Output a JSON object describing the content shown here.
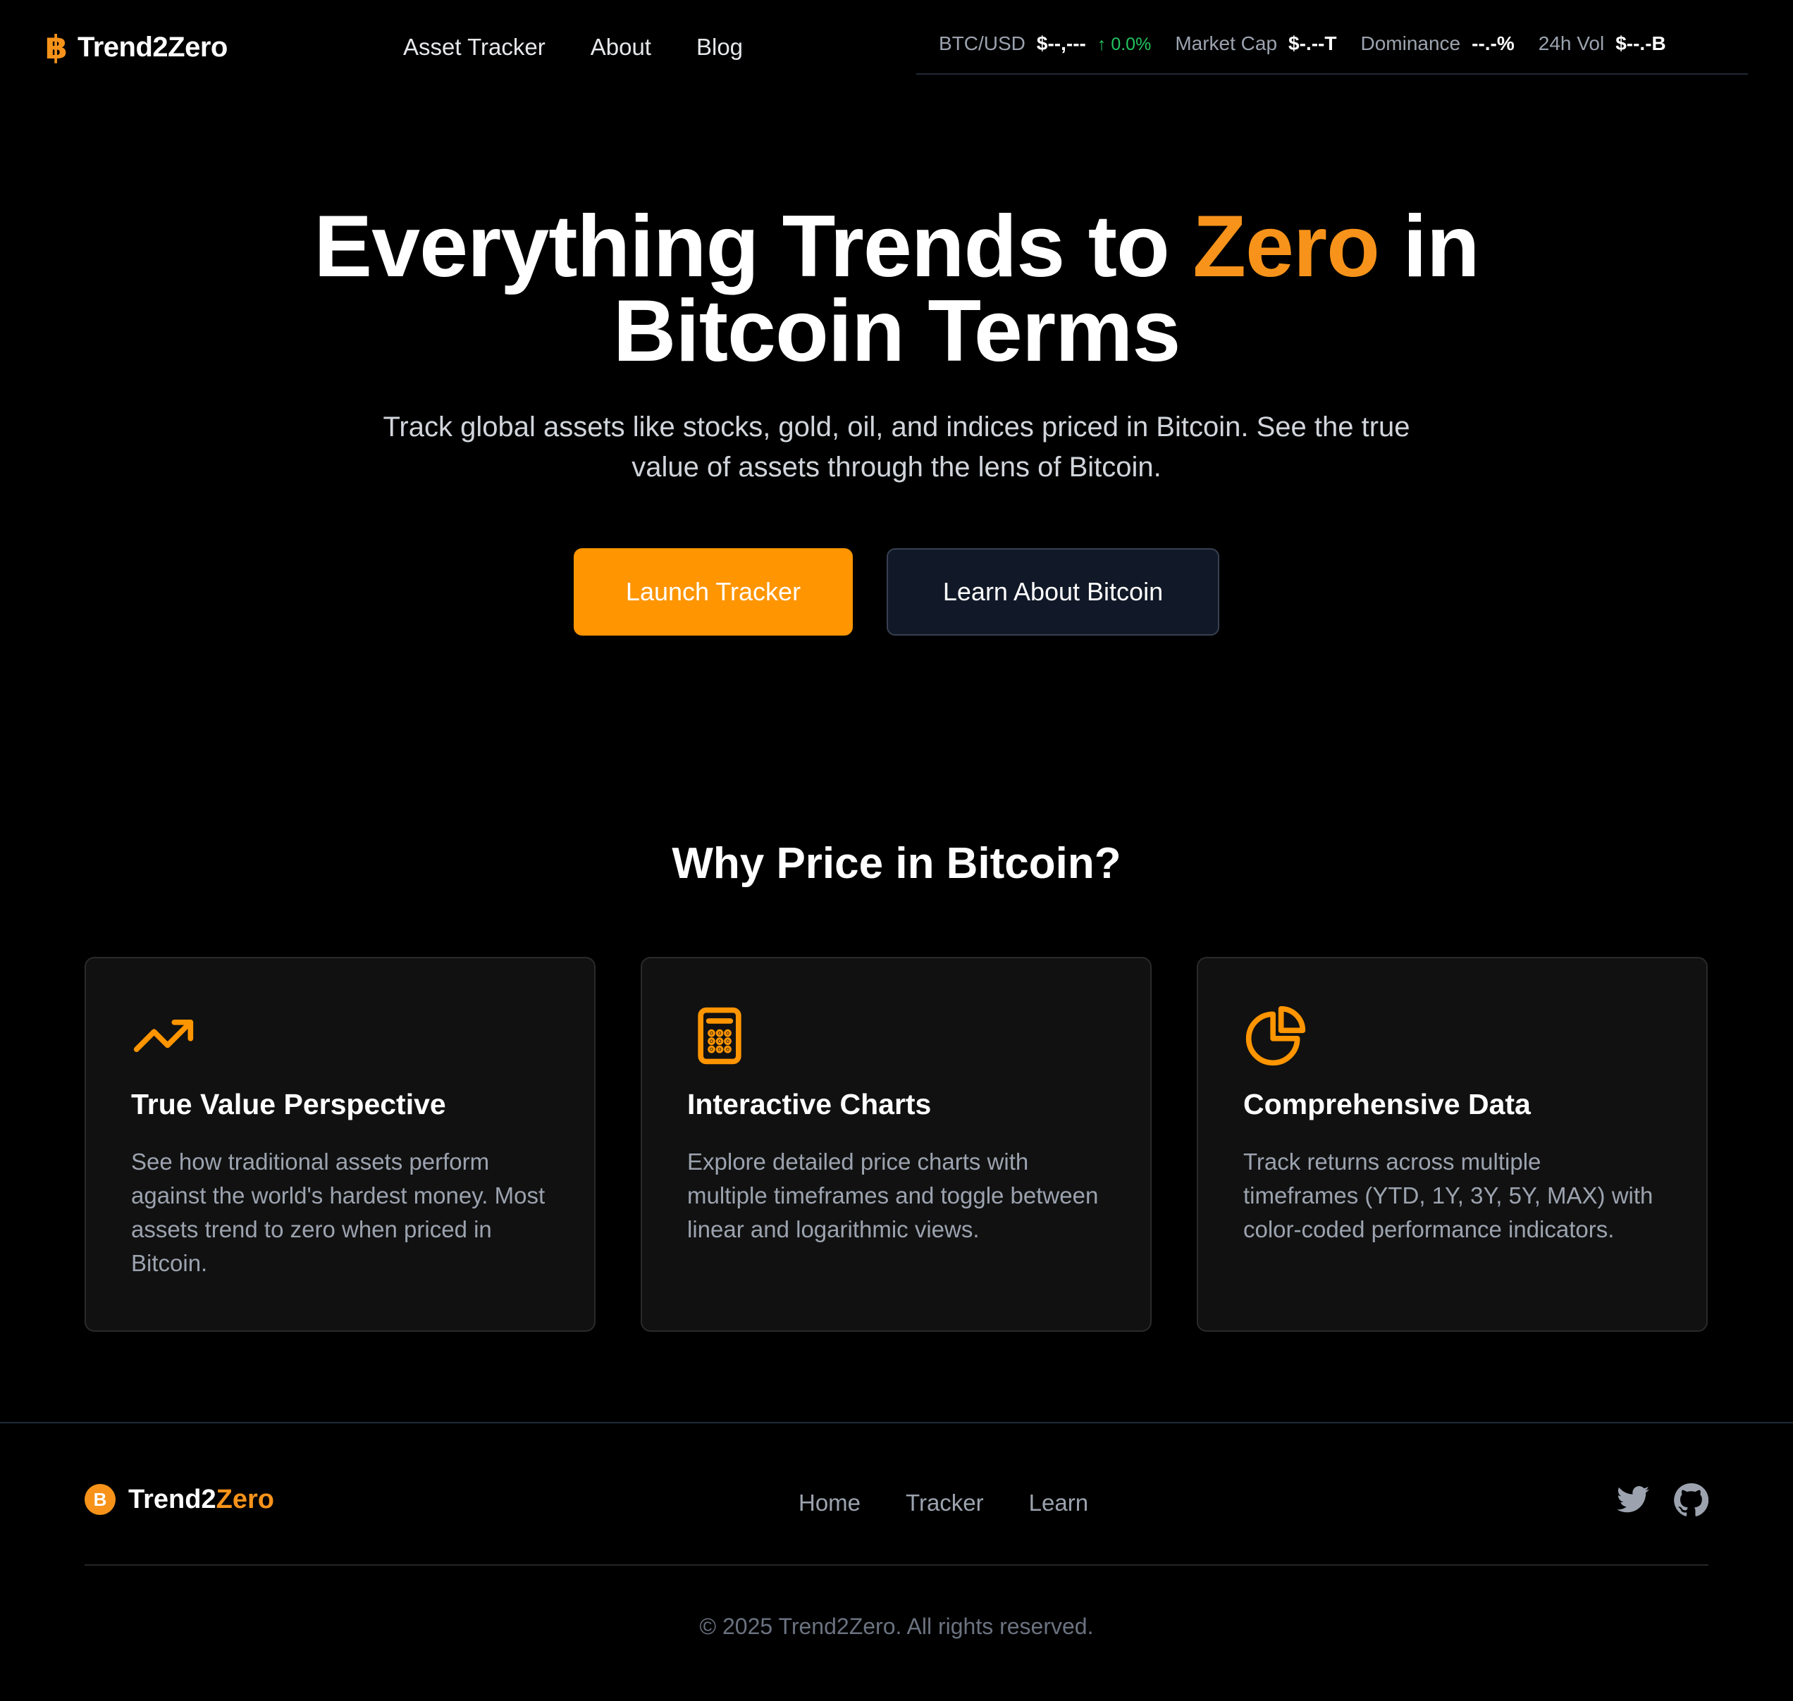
{
  "header": {
    "brand_glyph": "฿",
    "brand_name": "Trend2Zero",
    "nav": [
      "Asset Tracker",
      "About",
      "Blog"
    ]
  },
  "ticker": {
    "btc_label": "BTC/USD",
    "btc_value": "$--,---",
    "btc_change": "↑ 0.0%",
    "mcap_label": "Market Cap",
    "mcap_value": "$-.--T",
    "dom_label": "Dominance",
    "dom_value": "--.-%",
    "vol_label": "24h Vol",
    "vol_value": "$--.-B"
  },
  "hero": {
    "title_part1": "Everything Trends to ",
    "title_accent": "Zero",
    "title_part2": " in",
    "title_line2": "Bitcoin Terms",
    "subtitle": "Track global assets like stocks, gold, oil, and indices priced in Bitcoin. See the true value of assets through the lens of Bitcoin.",
    "primary_cta": "Launch Tracker",
    "secondary_cta": "Learn About Bitcoin"
  },
  "features": {
    "title": "Why Price in Bitcoin?",
    "cards": [
      {
        "icon": "trending-up-icon",
        "title": "True Value Perspective",
        "body": "See how traditional assets perform against the world's hardest money. Most assets trend to zero when priced in Bitcoin."
      },
      {
        "icon": "calculator-icon",
        "title": "Interactive Charts",
        "body": "Explore detailed price charts with multiple timeframes and toggle between linear and logarithmic views."
      },
      {
        "icon": "pie-chart-icon",
        "title": "Comprehensive Data",
        "body": "Track returns across multiple timeframes (YTD, 1Y, 3Y, 5Y, MAX) with color-coded performance indicators."
      }
    ]
  },
  "footer": {
    "coin_glyph": "B",
    "name_part1": "Trend2",
    "name_accent": "Zero",
    "links": [
      "Home",
      "Tracker",
      "Learn"
    ],
    "social": [
      "twitter-icon",
      "github-icon"
    ],
    "copyright": "© 2025 Trend2Zero. All rights reserved."
  },
  "colors": {
    "accent": "#f7931a",
    "cta_orange": "#ff9500",
    "positive": "#22c55e",
    "background": "#000000",
    "card_bg": "#111111"
  }
}
